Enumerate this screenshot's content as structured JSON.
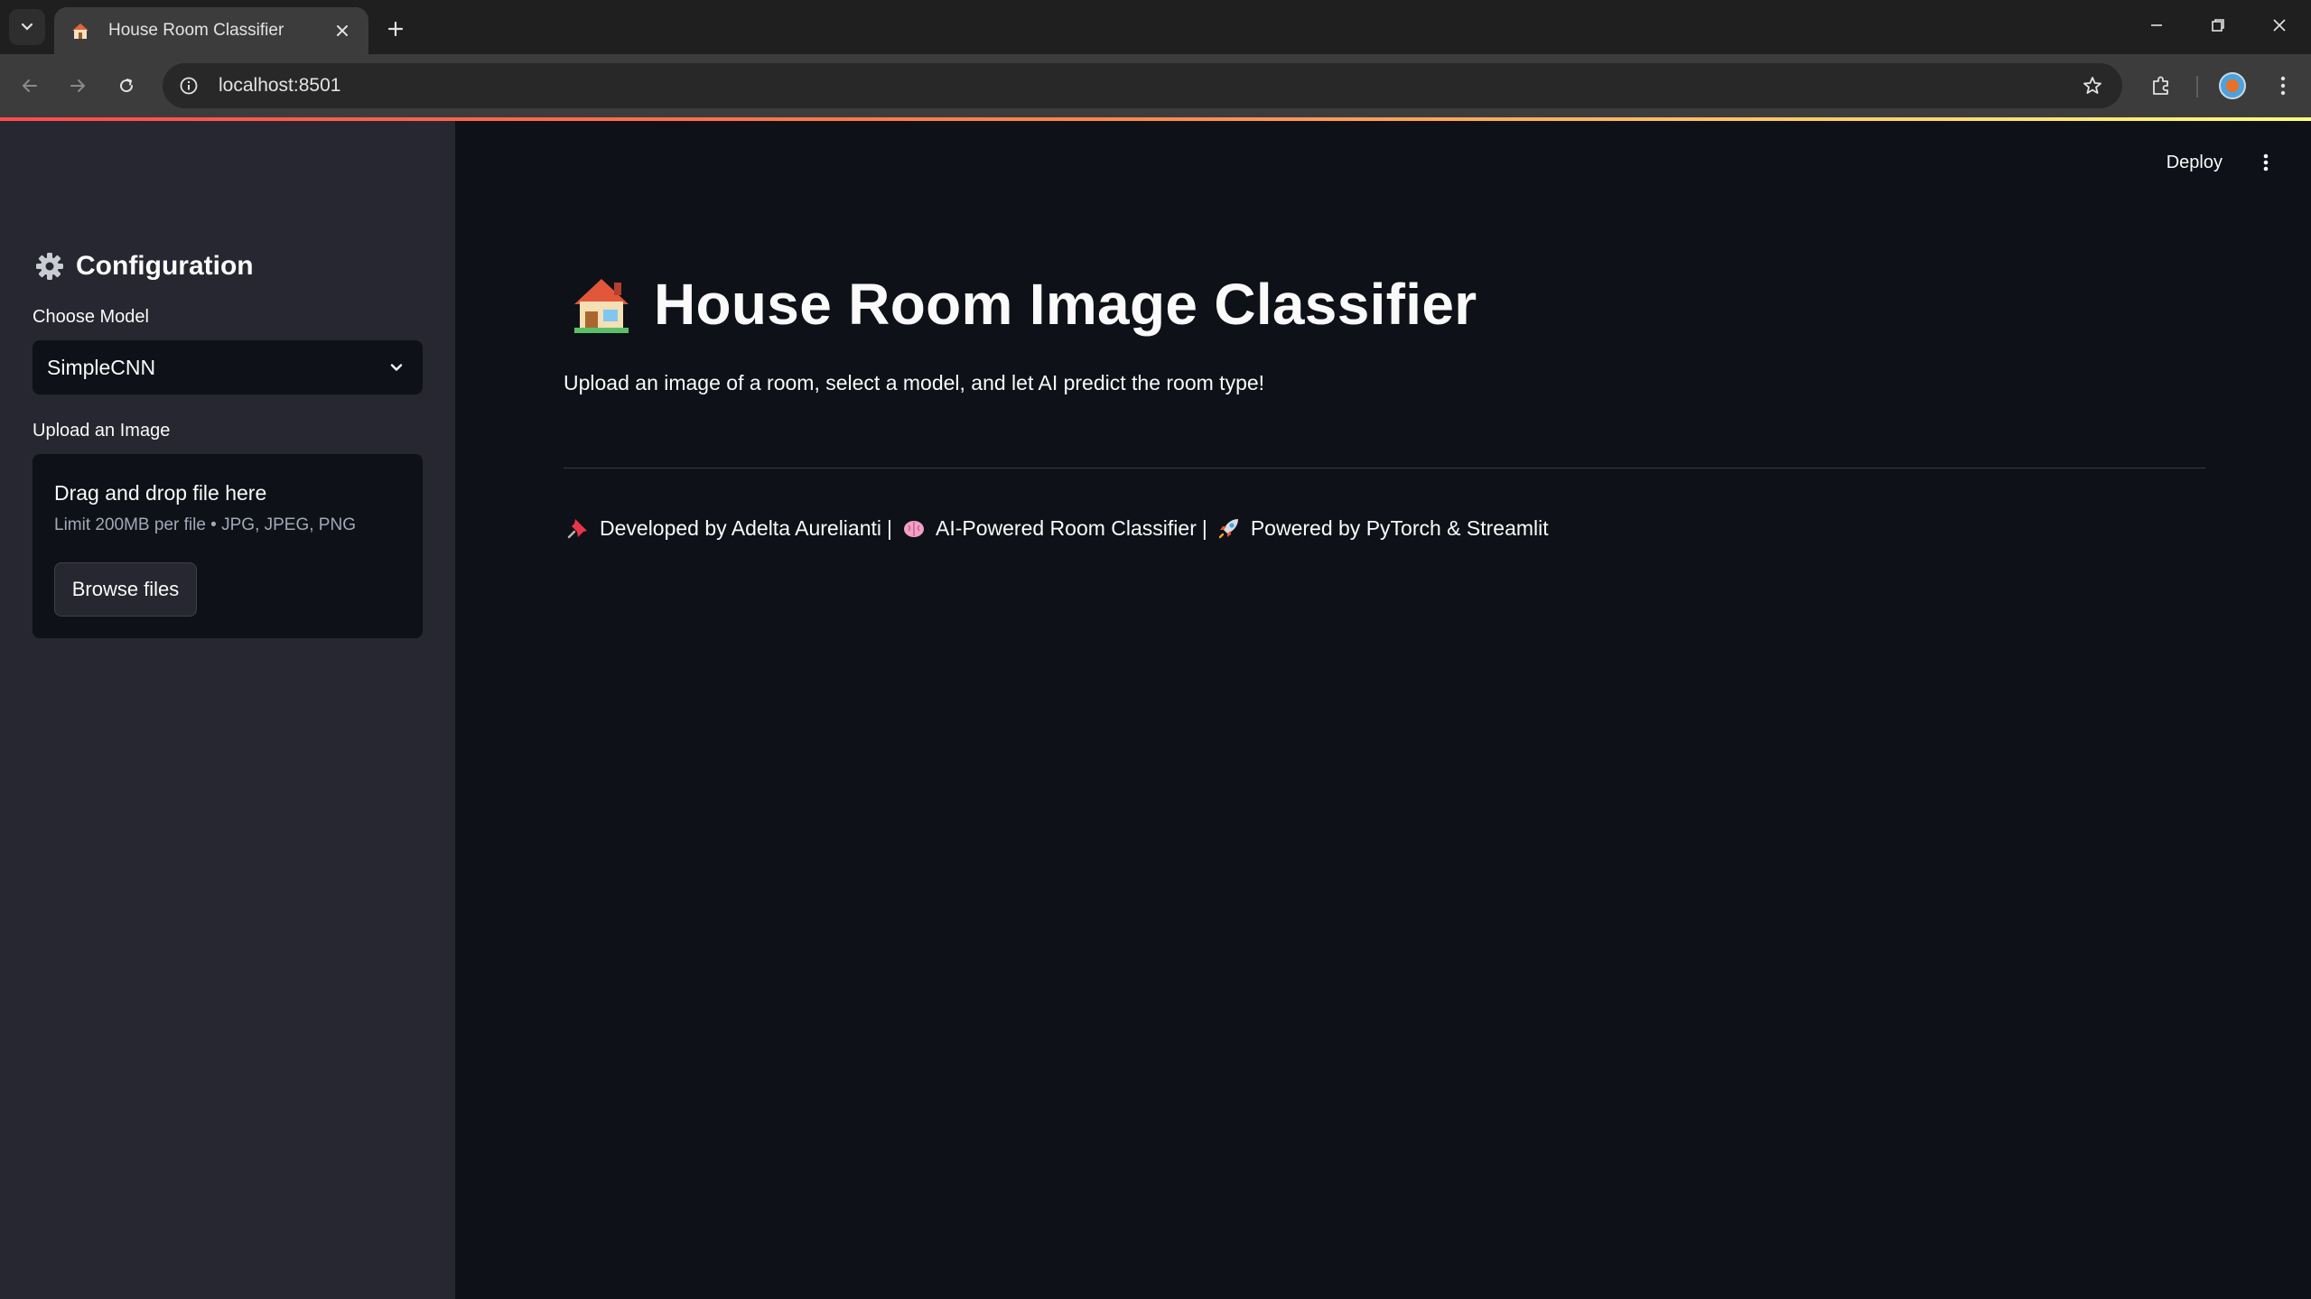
{
  "browser": {
    "tab_title": "House Room Classifier",
    "url": "localhost:8501"
  },
  "sidebar": {
    "header": "Configuration",
    "model_label": "Choose Model",
    "model_selected": "SimpleCNN",
    "upload_label": "Upload an Image",
    "dropzone_title": "Drag and drop file here",
    "dropzone_limits": "Limit 200MB per file • JPG, JPEG, PNG",
    "browse_label": "Browse files"
  },
  "header": {
    "deploy_label": "Deploy"
  },
  "main": {
    "title": "House Room Image Classifier",
    "subtitle": "Upload an image of a room, select a model, and let AI predict the room type!",
    "footer": {
      "part1": "Developed by Adelta Aurelianti",
      "separator": "|",
      "part2": "AI-Powered Room Classifier",
      "part3": "Powered by PyTorch & Streamlit"
    }
  },
  "icons": {
    "sidebar_header": "gear-icon",
    "title": "house-icon",
    "footer": [
      "pushpin-icon",
      "brain-icon",
      "rocket-icon"
    ]
  },
  "colors": {
    "app_background": "#0e1117",
    "sidebar_background": "#262730",
    "text": "#fafafa",
    "accent_gradient_start": "#ff4b4b",
    "accent_gradient_end": "#fffd80"
  }
}
